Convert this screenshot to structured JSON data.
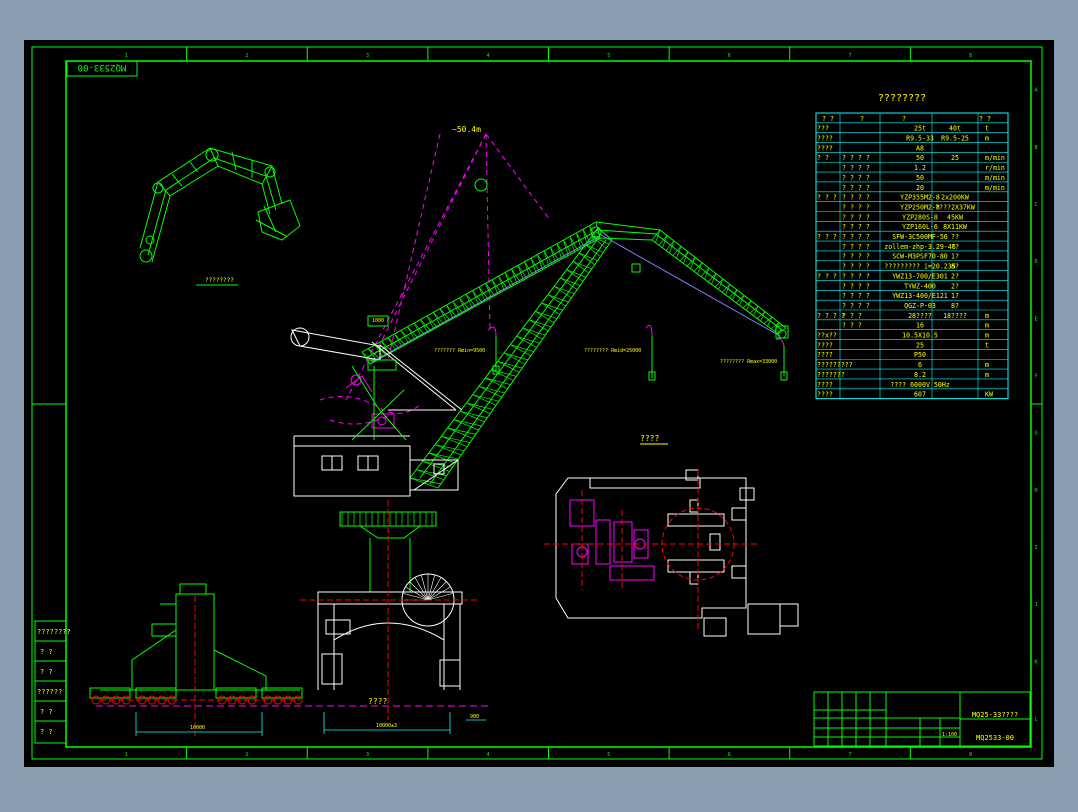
{
  "drawing": {
    "number_rotated": "MQ2533-00",
    "table_title": "????????",
    "plan_label": "????",
    "bucket_label": "????????",
    "ground_label": "????",
    "title_block": {
      "title": "MQ25-33????",
      "number": "MQ2533-00",
      "scale": "1:100"
    },
    "left_stamp": [
      "????????",
      "?  ?",
      "?  ?",
      "??????",
      "?  ?",
      "?  ?"
    ],
    "dimensions": {
      "outreach": "~50.4m",
      "jib_top": "1000",
      "rmin": "??????? Rmin=9500",
      "rmid": "???????? Rmid=25000",
      "rmax": "???????? Rmax=33000",
      "gauge": "10000",
      "base": "10000±3",
      "offset": "900"
    },
    "frame": {
      "top_marks": [
        "1",
        "2",
        "3",
        "4",
        "5",
        "6",
        "7",
        "8"
      ],
      "side_marks": [
        "A",
        "B",
        "C",
        "D",
        "E",
        "F",
        "G",
        "H",
        "I",
        "J",
        "K",
        "L"
      ]
    }
  },
  "spec_table": {
    "header": [
      "?  ?",
      "?",
      "?",
      "?  ?"
    ],
    "rows": [
      [
        "???",
        "",
        "25t",
        "40t",
        "t"
      ],
      [
        "????",
        "",
        "R9.5-33",
        "R9.5-25",
        "m"
      ],
      [
        "????",
        "",
        "A8",
        "",
        ""
      ],
      [
        "? ?",
        "? ? ? ?",
        "50",
        "25",
        "m/min"
      ],
      [
        "",
        "? ? ? ?",
        "1.2",
        "",
        "r/min"
      ],
      [
        "",
        "? ? ? ?",
        "50",
        "",
        "m/min"
      ],
      [
        "",
        "? ? ? ?",
        "20",
        "",
        "m/min"
      ],
      [
        "? ? ?",
        "? ? ? ?",
        "YZP355M2-8",
        "2x200KW",
        ""
      ],
      [
        "",
        "? ? ? ?",
        "YZP250M2-8",
        "????2X37KW",
        ""
      ],
      [
        "",
        "? ? ? ?",
        "YZP280S-8",
        "45KW",
        ""
      ],
      [
        "",
        "? ? ? ?",
        "YZP160L-6",
        "8X11KW",
        ""
      ],
      [
        "? ? ?",
        "? ? ? ?",
        "SFW-3C500MF-56",
        "??",
        ""
      ],
      [
        "",
        "? ? ? ?",
        "zollem-zhp-3.29-46",
        "??",
        ""
      ],
      [
        "",
        "? ? ? ?",
        "SCW-M3PSF70-80",
        "1?",
        ""
      ],
      [
        "",
        "? ? ? ?",
        "????????? i=20.235",
        "8?",
        ""
      ],
      [
        "? ? ?",
        "? ? ? ?",
        "YWZ13-700/E301",
        "2?",
        ""
      ],
      [
        "",
        "? ? ? ?",
        "TYWZ-400",
        "2?",
        ""
      ],
      [
        "",
        "? ? ? ?",
        "YWZ13-400/E121",
        "1?",
        ""
      ],
      [
        "",
        "? ? ? ?",
        "QGZ-P-03",
        "8?",
        ""
      ],
      [
        "? ? ? ?",
        "?  ?  ?",
        "28????",
        "18????",
        "m"
      ],
      [
        "",
        "?  ?  ?",
        "16",
        "",
        "m"
      ],
      [
        "??x??",
        "",
        "10.5X10.5",
        "",
        "m"
      ],
      [
        "????",
        "",
        "25",
        "",
        "t"
      ],
      [
        "????",
        "",
        "P50",
        "",
        ""
      ],
      [
        "?????????",
        "",
        "6",
        "",
        "m"
      ],
      [
        "???????",
        "",
        "8.2",
        "",
        "m"
      ],
      [
        "????",
        "",
        "????  6000V  50Hz",
        "",
        ""
      ],
      [
        "????",
        "",
        "607",
        "",
        "KW"
      ]
    ]
  },
  "colors": {
    "frame": "#00ff00",
    "crane": "#00ff00",
    "cabin": "#ffffff",
    "center_lines": "#ff0000",
    "reach": "#ff00ff",
    "rope": "#3a3aff",
    "dims": "#00ffff",
    "text": "#ffff00"
  }
}
